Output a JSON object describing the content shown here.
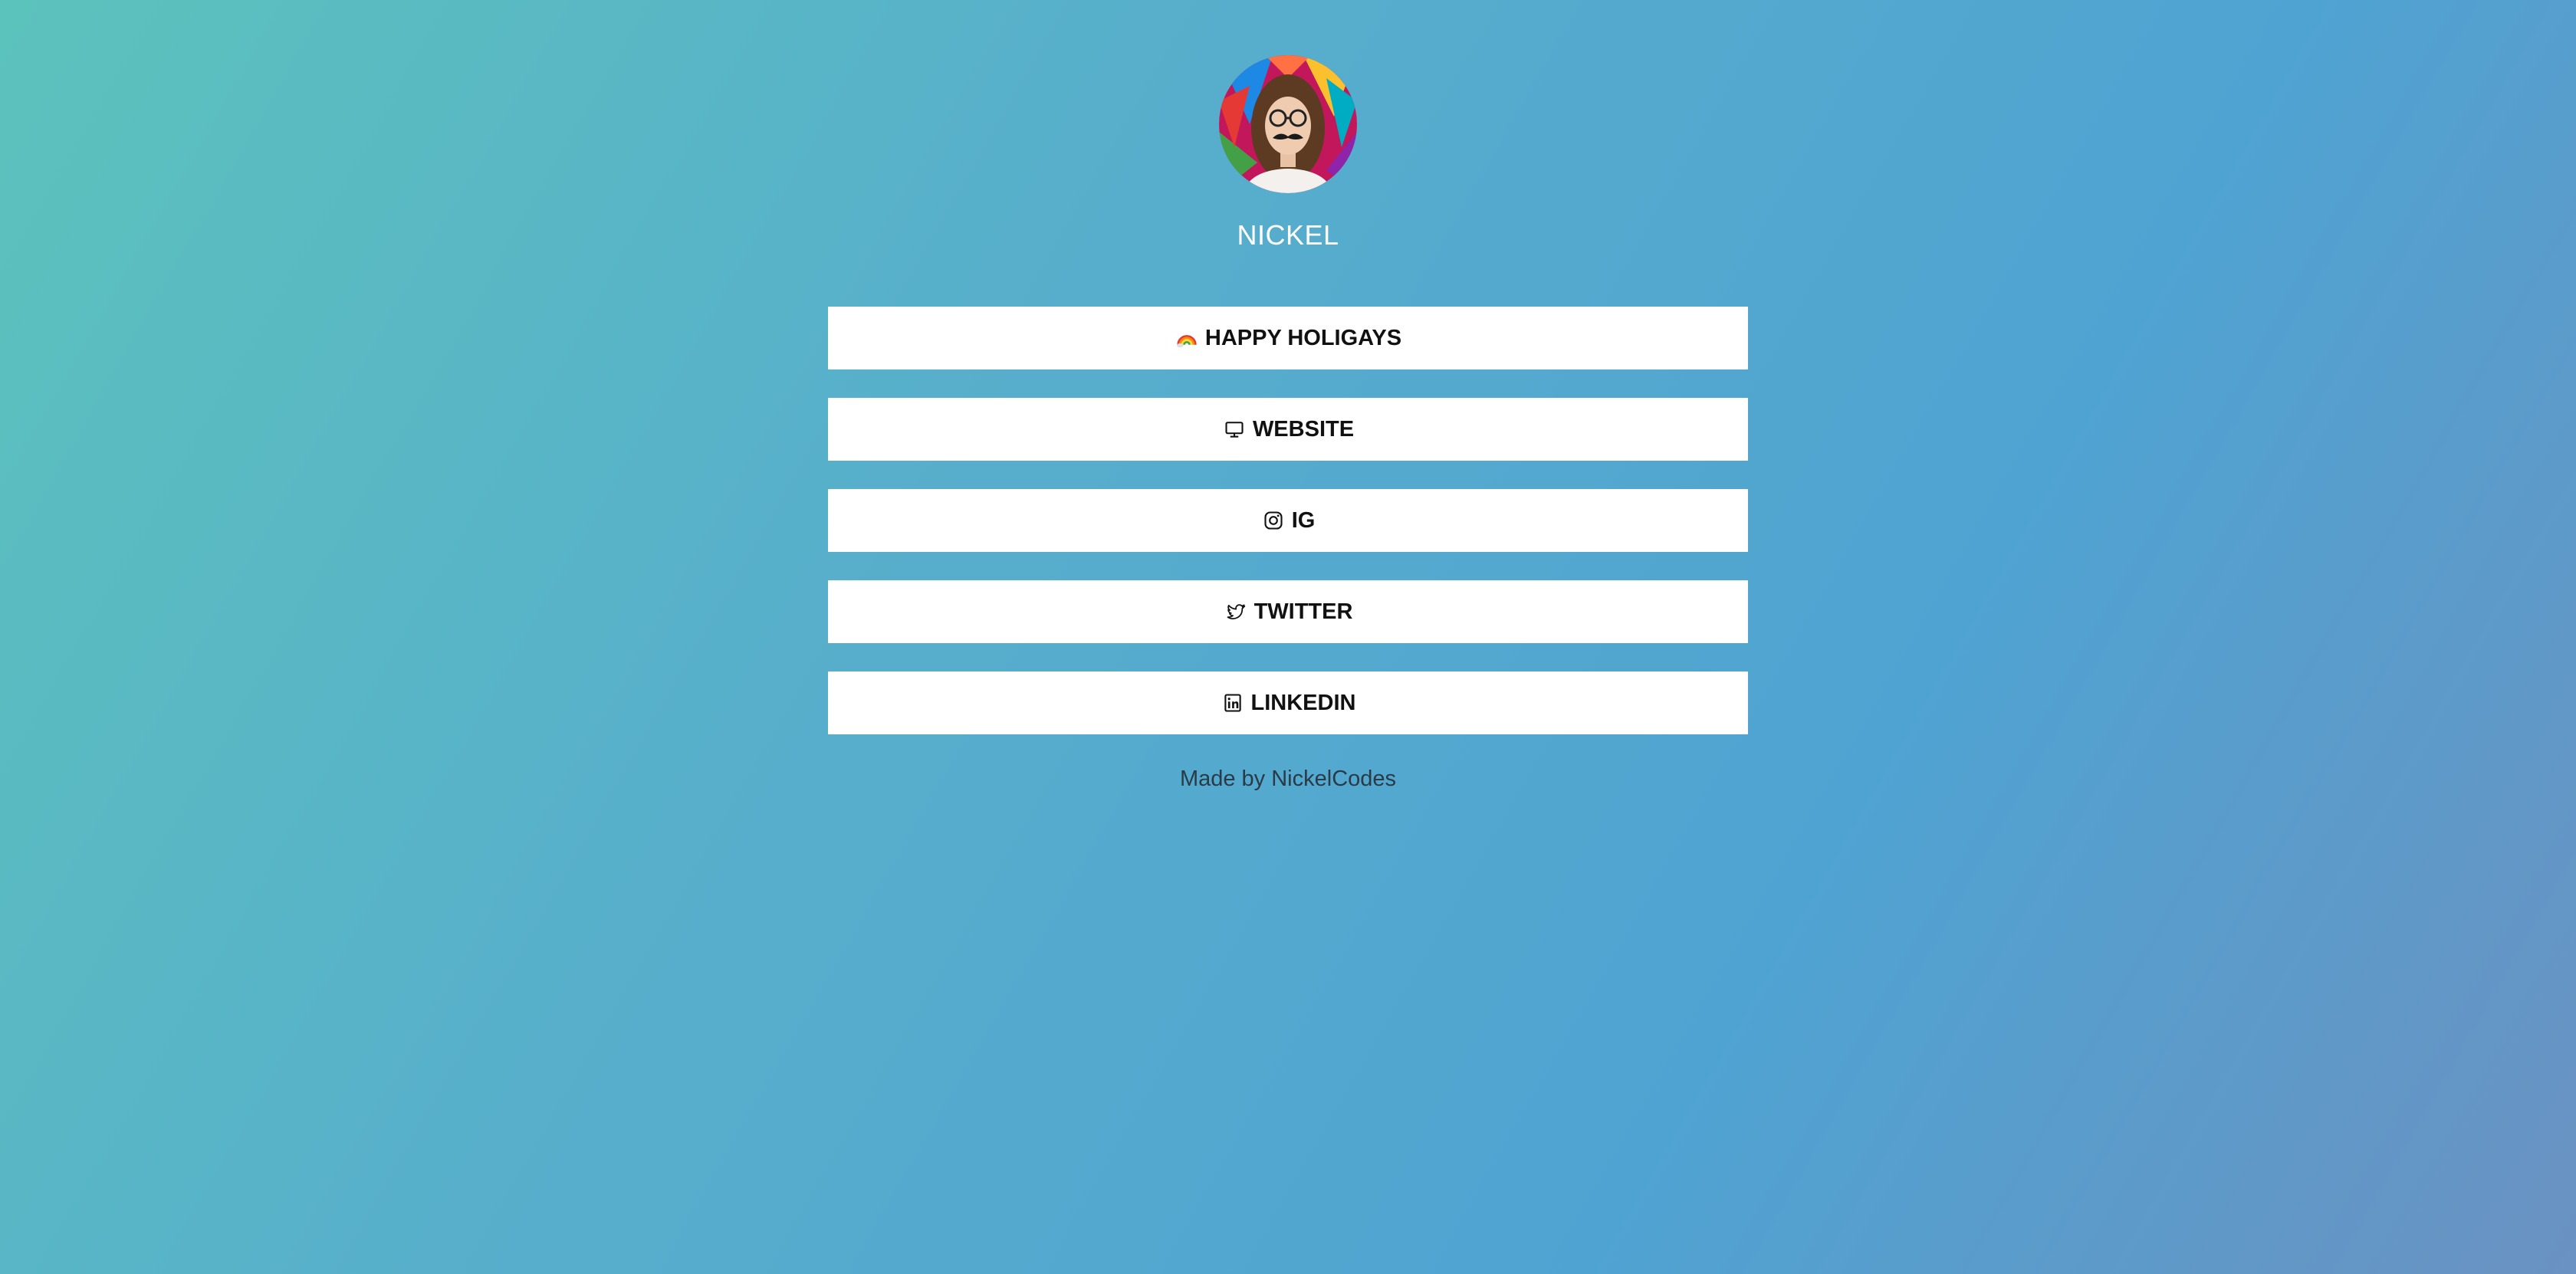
{
  "profile": {
    "name": "NICKEL",
    "avatar_icon": "profile-photo"
  },
  "links": [
    {
      "label": "HAPPY HOLIGAYS",
      "icon": "rainbow-icon"
    },
    {
      "label": "WEBSITE",
      "icon": "monitor-icon"
    },
    {
      "label": "IG",
      "icon": "instagram-icon"
    },
    {
      "label": "TWITTER",
      "icon": "twitter-icon"
    },
    {
      "label": "LINKEDIN",
      "icon": "linkedin-icon"
    }
  ],
  "footer": {
    "text": "Made by NickelCodes"
  },
  "colors": {
    "gradient_start": "#5cc2bc",
    "gradient_end": "#6a92c2",
    "button_bg": "#ffffff"
  }
}
